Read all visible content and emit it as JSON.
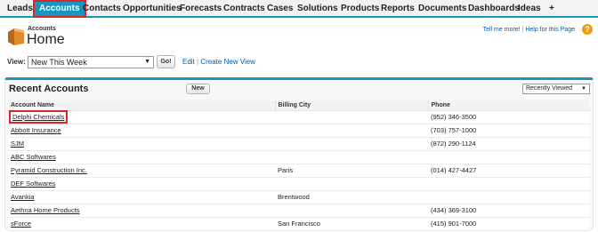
{
  "tabs": [
    {
      "label": "Leads",
      "active": false
    },
    {
      "label": "Accounts",
      "active": true
    },
    {
      "label": "Contacts",
      "active": false
    },
    {
      "label": "Opportunities",
      "active": false
    },
    {
      "label": "Forecasts",
      "active": false
    },
    {
      "label": "Contracts",
      "active": false
    },
    {
      "label": "Cases",
      "active": false
    },
    {
      "label": "Solutions",
      "active": false
    },
    {
      "label": "Products",
      "active": false
    },
    {
      "label": "Reports",
      "active": false
    },
    {
      "label": "Documents",
      "active": false
    },
    {
      "label": "Dashboards",
      "active": false
    },
    {
      "label": "Ideas",
      "active": false
    },
    {
      "label": "+",
      "active": false
    }
  ],
  "header": {
    "object_label": "Accounts",
    "title": "Home",
    "help_text": "Tell me more!",
    "help_sep": " | ",
    "help_link": "Help for this Page",
    "help_icon": "question-icon"
  },
  "view": {
    "label": "View:",
    "selected": "New This Week",
    "go_label": "Go!",
    "edit_label": "Edit",
    "sep": " | ",
    "create_label": "Create New View"
  },
  "panel": {
    "title": "Recent Accounts",
    "new_label": "New",
    "recent_select": "Recently Viewed",
    "columns": [
      "Account Name",
      "Billing City",
      "Phone"
    ],
    "rows": [
      {
        "name": "Delphi Chemicals",
        "city": "",
        "phone": "(952) 346-3500",
        "highlighted": true
      },
      {
        "name": "Abbott Insurance",
        "city": "",
        "phone": "(703) 757-1000"
      },
      {
        "name": "SJM",
        "city": "",
        "phone": "(872) 290-1124"
      },
      {
        "name": "ABC Softwares",
        "city": "",
        "phone": ""
      },
      {
        "name": "Pyramid Construction Inc.",
        "city": "Paris",
        "phone": "(014) 427-4427"
      },
      {
        "name": "DEF Softwares",
        "city": "",
        "phone": ""
      },
      {
        "name": "Avankia",
        "city": "Brentwood",
        "phone": ""
      },
      {
        "name": "Aethna Home Products",
        "city": "",
        "phone": "(434) 369-3100"
      },
      {
        "name": "sForce",
        "city": "San Francisco",
        "phone": "(415) 901-7000"
      }
    ]
  },
  "colors": {
    "accent": "#1797c0",
    "highlight": "#d8262c",
    "link": "#015ba7"
  }
}
